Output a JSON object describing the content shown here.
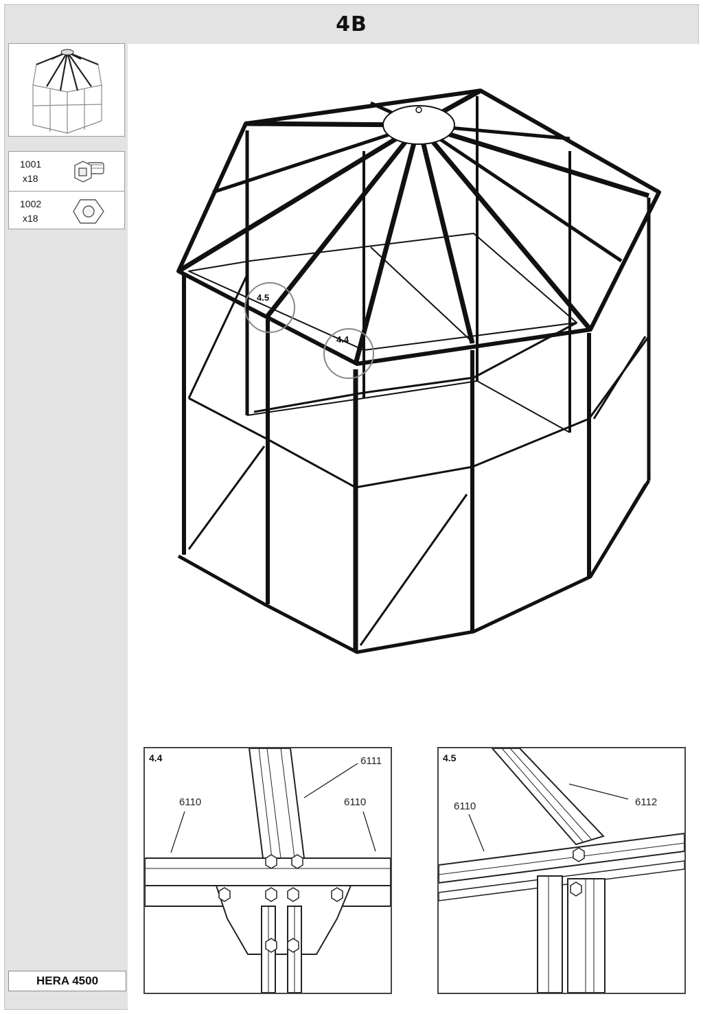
{
  "page": {
    "step": "4B",
    "model": "HERA 4500"
  },
  "parts": [
    {
      "code": "1001",
      "qty": "x18",
      "icon": "bolt-icon"
    },
    {
      "code": "1002",
      "qty": "x18",
      "icon": "hex-nut-icon"
    }
  ],
  "callouts": [
    "4.5",
    "4.4"
  ],
  "details": {
    "d44": {
      "id": "4.4",
      "labels": [
        "6111",
        "6110",
        "6110"
      ]
    },
    "d45": {
      "id": "4.5",
      "labels": [
        "6110",
        "6112"
      ]
    }
  }
}
